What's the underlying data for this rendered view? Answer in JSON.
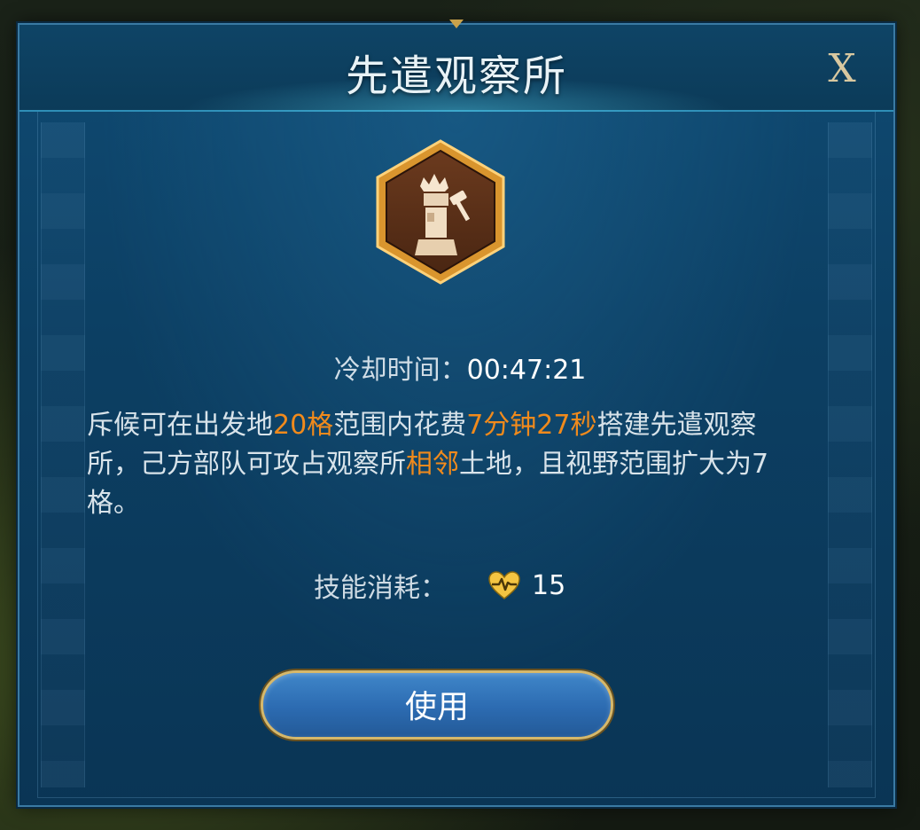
{
  "dialog": {
    "title": "先遣观察所",
    "close_label": "X"
  },
  "skill": {
    "icon": "watchtower-hammer-icon",
    "cooldown_label": "冷却时间：",
    "cooldown_value": "00:47:21",
    "description": {
      "p1": "斥候可在出发地",
      "h1": "20格",
      "p2": "范围内花费",
      "h2": "7分钟27秒",
      "p3": "搭建先遣观察所，己方部队可攻占观察所",
      "h3": "相邻",
      "p4": "土地，且视野范围扩大为7格。"
    },
    "cost_label": "技能消耗：",
    "cost_icon": "heart-pulse-icon",
    "cost_value": "15"
  },
  "actions": {
    "use_label": "使用"
  },
  "colors": {
    "highlight": "#f08a1c",
    "button_border": "#d6b86a"
  }
}
